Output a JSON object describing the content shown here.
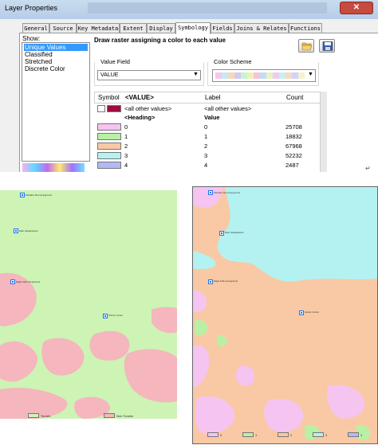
{
  "window": {
    "title": "Layer Properties",
    "close_glyph": "✕"
  },
  "tabs": [
    "General",
    "Source",
    "Key Metadata",
    "Extent",
    "Display",
    "Symbology",
    "Fields",
    "Joins & Relates",
    "Functions"
  ],
  "active_tab": "Symbology",
  "show": {
    "label": "Show:",
    "items": [
      "Unique Values",
      "Classified",
      "Stretched",
      "Discrete Color"
    ],
    "selected": "Unique Values"
  },
  "symbology": {
    "heading": "Draw raster assigning a color to each value",
    "open_icon": "folder-open-icon",
    "save_icon": "save-icon",
    "value_field": {
      "label": "Value Field",
      "value": "VALUE"
    },
    "color_scheme": {
      "label": "Color Scheme"
    },
    "table": {
      "headers": {
        "symbol": "Symbol",
        "value": "<VALUE>",
        "label": "Label",
        "count": "Count"
      },
      "all_other": {
        "value": "<all other values>",
        "label": "<all other values>",
        "color": "#a00d3c"
      },
      "heading_row": {
        "value": "<Heading>",
        "label": "Value"
      },
      "rows": [
        {
          "value": "0",
          "label": "0",
          "count": "25708",
          "color": "#f6c4f0"
        },
        {
          "value": "1",
          "label": "1",
          "count": "18832",
          "color": "#b9f0a6"
        },
        {
          "value": "2",
          "label": "2",
          "count": "67968",
          "color": "#f8c9a4"
        },
        {
          "value": "3",
          "label": "3",
          "count": "52232",
          "color": "#b4f2f1"
        },
        {
          "value": "4",
          "label": "4",
          "count": "2487",
          "color": "#b3b9f4"
        }
      ]
    },
    "return_mark": "↵"
  },
  "map_left": {
    "places": [
      "Paradise Flat campground",
      "Main Headquarters",
      "Eagle Falls campground",
      "History Center"
    ],
    "legend": [
      {
        "label": "Tonsilo",
        "color": "#cdf3b5"
      },
      {
        "label": "Non Tonsilo",
        "color": "#f5b6bd"
      }
    ],
    "colors": {
      "green": "#cdf3b5",
      "pink": "#f5b6bd"
    }
  },
  "map_right": {
    "places": [
      "Paradise Flat campground",
      "Main Headquarters",
      "Eagle Falls campground",
      "History Center"
    ],
    "legend": [
      {
        "label": "0",
        "color": "#f6c4f0"
      },
      {
        "label": "1",
        "color": "#b9f0a6"
      },
      {
        "label": "2",
        "color": "#f8c9a4"
      },
      {
        "label": "3",
        "color": "#b4f2f1"
      },
      {
        "label": "4",
        "color": "#b3b9f4"
      }
    ],
    "colors": {
      "cyan": "#b4f2f1",
      "orange": "#f8c9a4",
      "pink": "#f6c4f0",
      "green": "#b9f0a6"
    }
  }
}
